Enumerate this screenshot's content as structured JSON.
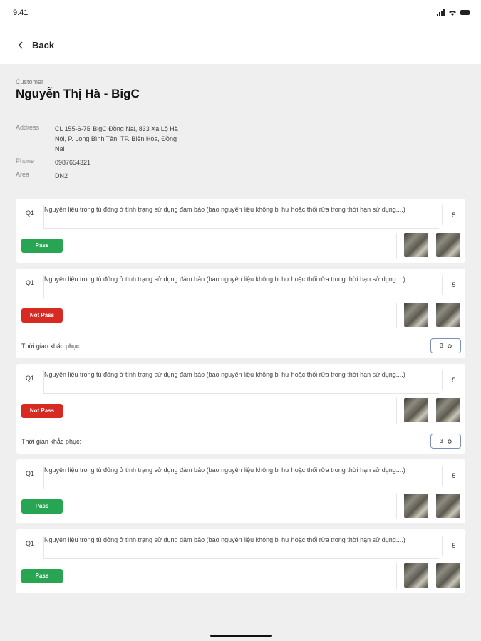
{
  "status_bar": {
    "time": "9:41"
  },
  "nav": {
    "back_label": "Back"
  },
  "customer": {
    "label": "Customer",
    "name": "Nguyễn Thị Hà - BigC",
    "address_label": "Address",
    "address": "CL 155-6-7B BigC Đồng Nai, 833 Xa Lộ Hà Nội, P. Long Bình Tân, TP. Biên Hòa, Đồng Nai",
    "phone_label": "Phone",
    "phone": "0987654321",
    "area_label": "Area",
    "area": "DN2"
  },
  "items": [
    {
      "num": "Q1",
      "text": "Nguyên liệu trong tủ đông ở tình trạng sử dụng đảm bảo (bao nguyên liệu không bị hư hoặc thối rữa trong thời hạn sử dụng....)",
      "score": "5",
      "status": "Pass"
    },
    {
      "num": "Q1",
      "text": "Nguyên liệu trong tủ đông ở tình trạng sử dụng đảm bảo (bao nguyên liệu không bị hư hoặc thối rữa trong thời hạn sử dụng....)",
      "score": "5",
      "status": "Not Pass",
      "fix_label": "Thời gian khắc phục:",
      "fix_value": "3",
      "fix_unit_icon": "chevron-icon"
    },
    {
      "num": "Q1",
      "text": "Nguyên liệu trong tủ đông ở tình trạng sử dụng đảm bảo (bao nguyên liệu không bị hư hoặc thối rữa trong thời hạn sử dụng....)",
      "score": "5",
      "status": "Not Pass",
      "fix_label": "Thời gian khắc phục:",
      "fix_value": "3",
      "fix_unit_icon": "chevron-icon"
    },
    {
      "num": "Q1",
      "text": "Nguyên liệu trong tủ đông ở tình trạng sử dụng đảm bảo (bao nguyên liệu không bị hư hoặc thối rữa trong thời hạn sử dụng....)",
      "score": "5",
      "status": "Pass"
    },
    {
      "num": "Q1",
      "text": "Nguyên liệu trong tủ đông ở tình trạng sử dụng đảm bảo (bao nguyên liệu không bị hư hoặc thối rữa trong thời hạn sử dụng....)",
      "score": "5",
      "status": "Pass"
    }
  ],
  "colors": {
    "pass": "#27a552",
    "not_pass": "#d62a22",
    "background": "#efefef"
  }
}
